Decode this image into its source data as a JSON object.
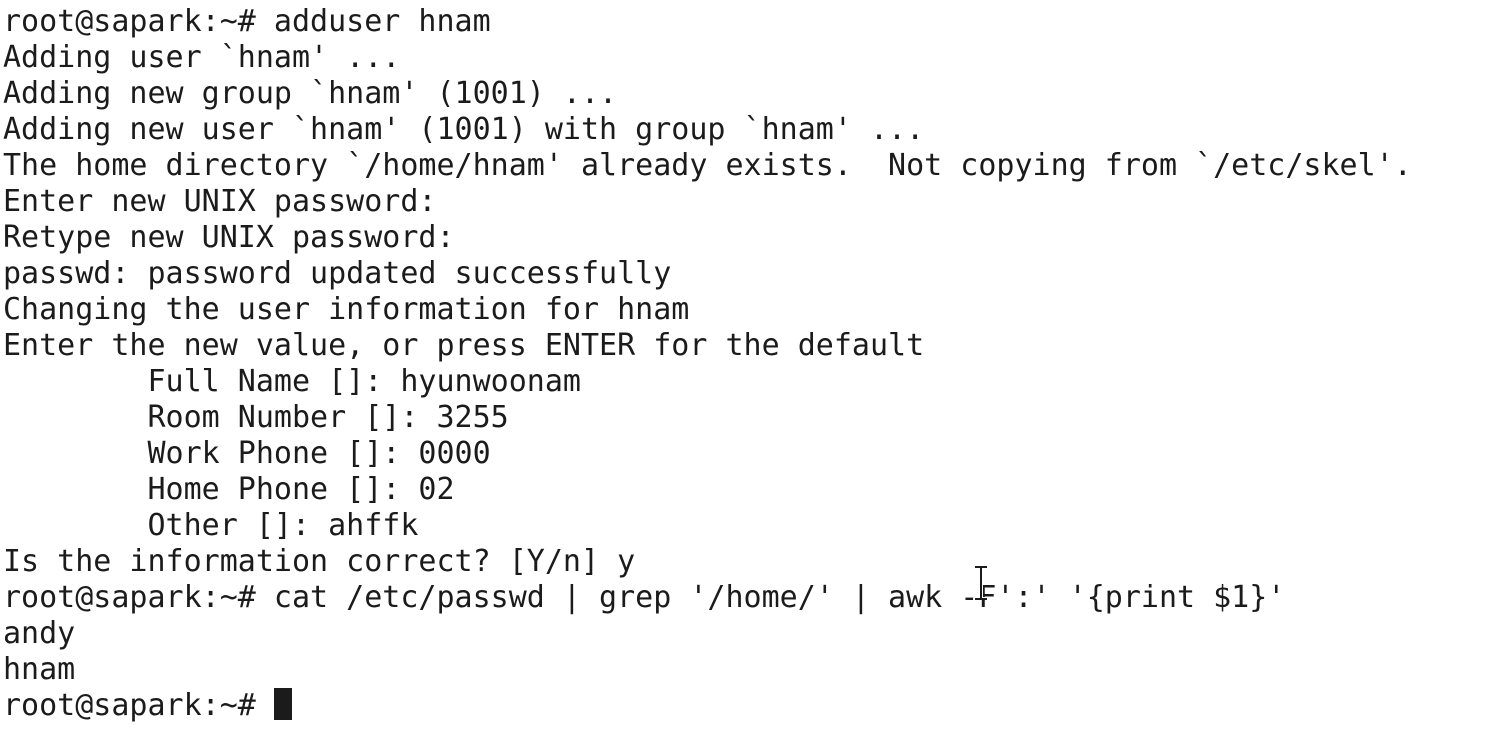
{
  "terminal": {
    "lines": [
      "root@sapark:~# adduser hnam",
      "Adding user `hnam' ...",
      "Adding new group `hnam' (1001) ...",
      "Adding new user `hnam' (1001) with group `hnam' ...",
      "The home directory `/home/hnam' already exists.  Not copying from `/etc/skel'.",
      "Enter new UNIX password:",
      "Retype new UNIX password:",
      "passwd: password updated successfully",
      "Changing the user information for hnam",
      "Enter the new value, or press ENTER for the default",
      "        Full Name []: hyunwoonam",
      "        Room Number []: 3255",
      "        Work Phone []: 0000",
      "        Home Phone []: 02",
      "        Other []: ahffk",
      "Is the information correct? [Y/n] y",
      "root@sapark:~# cat /etc/passwd | grep '/home/' | awk -F':' '{print $1}'",
      "andy",
      "hnam"
    ],
    "prompt": "root@sapark:~# ",
    "icons": {
      "text_cursor": "text-cursor-block-icon",
      "mouse_pointer": "i-beam-cursor-icon"
    }
  }
}
